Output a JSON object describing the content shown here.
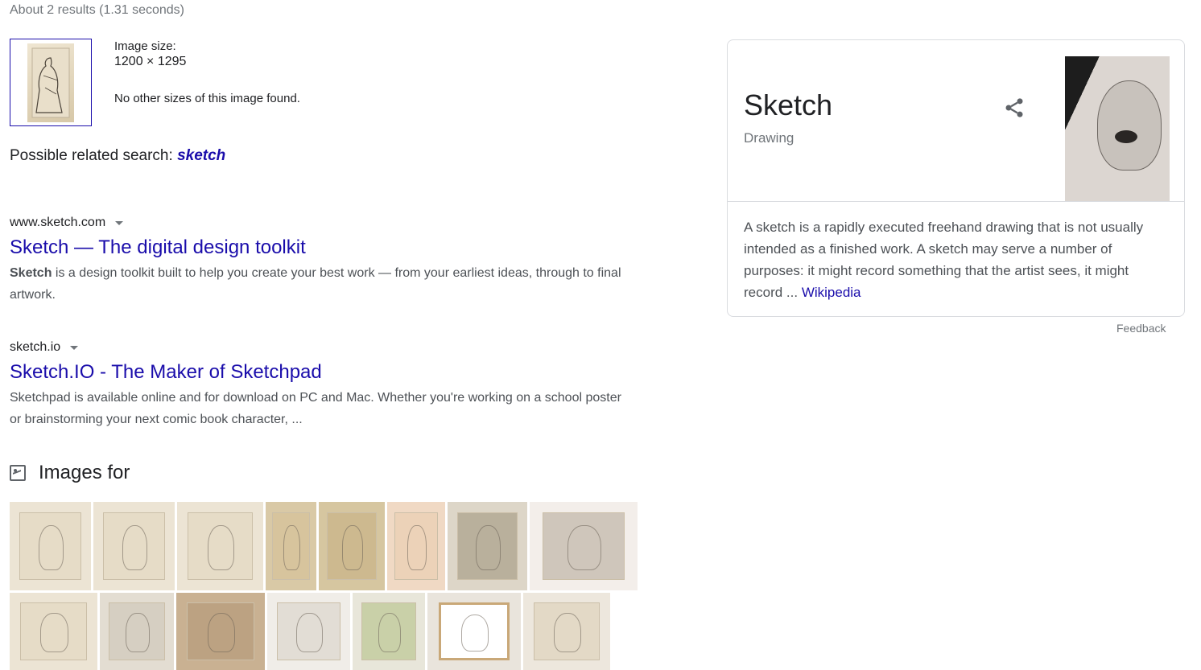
{
  "stats": "About 2 results (1.31 seconds)",
  "image_info": {
    "size_label": "Image size:",
    "size_value": "1200 × 1295",
    "no_other": "No other sizes of this image found."
  },
  "related": {
    "prefix": "Possible related search: ",
    "query": "sketch"
  },
  "results": [
    {
      "url": "www.sketch.com",
      "title": "Sketch — The digital design toolkit",
      "snippet_bold": "Sketch",
      "snippet": " is a design toolkit built to help you create your best work — from your earliest ideas, through to final artwork."
    },
    {
      "url": "sketch.io",
      "title": "Sketch.IO - The Maker of Sketchpad",
      "snippet": "Sketchpad is available online and for download on PC and Mac. Whether you're working on a school poster or brainstorming your next comic book character, ..."
    }
  ],
  "images_heading": "Images for",
  "knowledge_panel": {
    "title": "Sketch",
    "subtitle": "Drawing",
    "description": "A sketch is a rapidly executed freehand drawing that is not usually intended as a finished work. A sketch may serve a number of purposes: it might record something that the artist sees, it might record ... ",
    "source_link": "Wikipedia",
    "share_icon": "share-icon"
  },
  "feedback": "Feedback",
  "colors": {
    "link": "#1a0dab",
    "text": "#202124",
    "muted": "#70757a",
    "snippet": "#4d5156",
    "border": "#dadce0"
  }
}
